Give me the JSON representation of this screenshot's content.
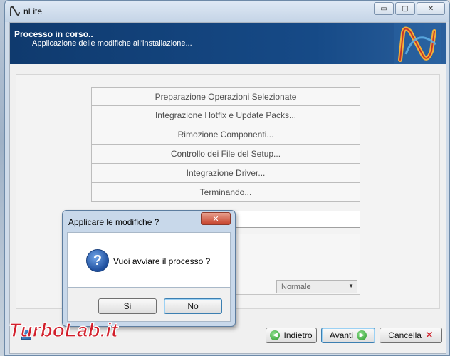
{
  "window": {
    "title": "nLite"
  },
  "caption_buttons": {
    "minimize": "▭",
    "maximize": "▢",
    "close": "✕"
  },
  "header": {
    "title": "Processo in corso..",
    "subtitle": "Applicazione delle modifiche all'installazione..."
  },
  "steps": [
    "Preparazione Operazioni Selezionate",
    "Integrazione Hotfix e Update Packs...",
    "Rimozione Componenti...",
    "Controllo dei File del Setup...",
    "Integrazione Driver...",
    "Terminando..."
  ],
  "priority": {
    "selected": "Normale"
  },
  "nav": {
    "back": "Indietro",
    "next": "Avanti",
    "cancel": "Cancella"
  },
  "dialog": {
    "title": "Applicare le modifiche ?",
    "message": "Vuoi avviare il processo ?",
    "yes": "Si",
    "no": "No"
  },
  "watermark": {
    "text": "TurboLab.it"
  },
  "colors": {
    "header": "#164a87",
    "accent": "#3c7fb1",
    "watermark": "#d21f2b"
  }
}
